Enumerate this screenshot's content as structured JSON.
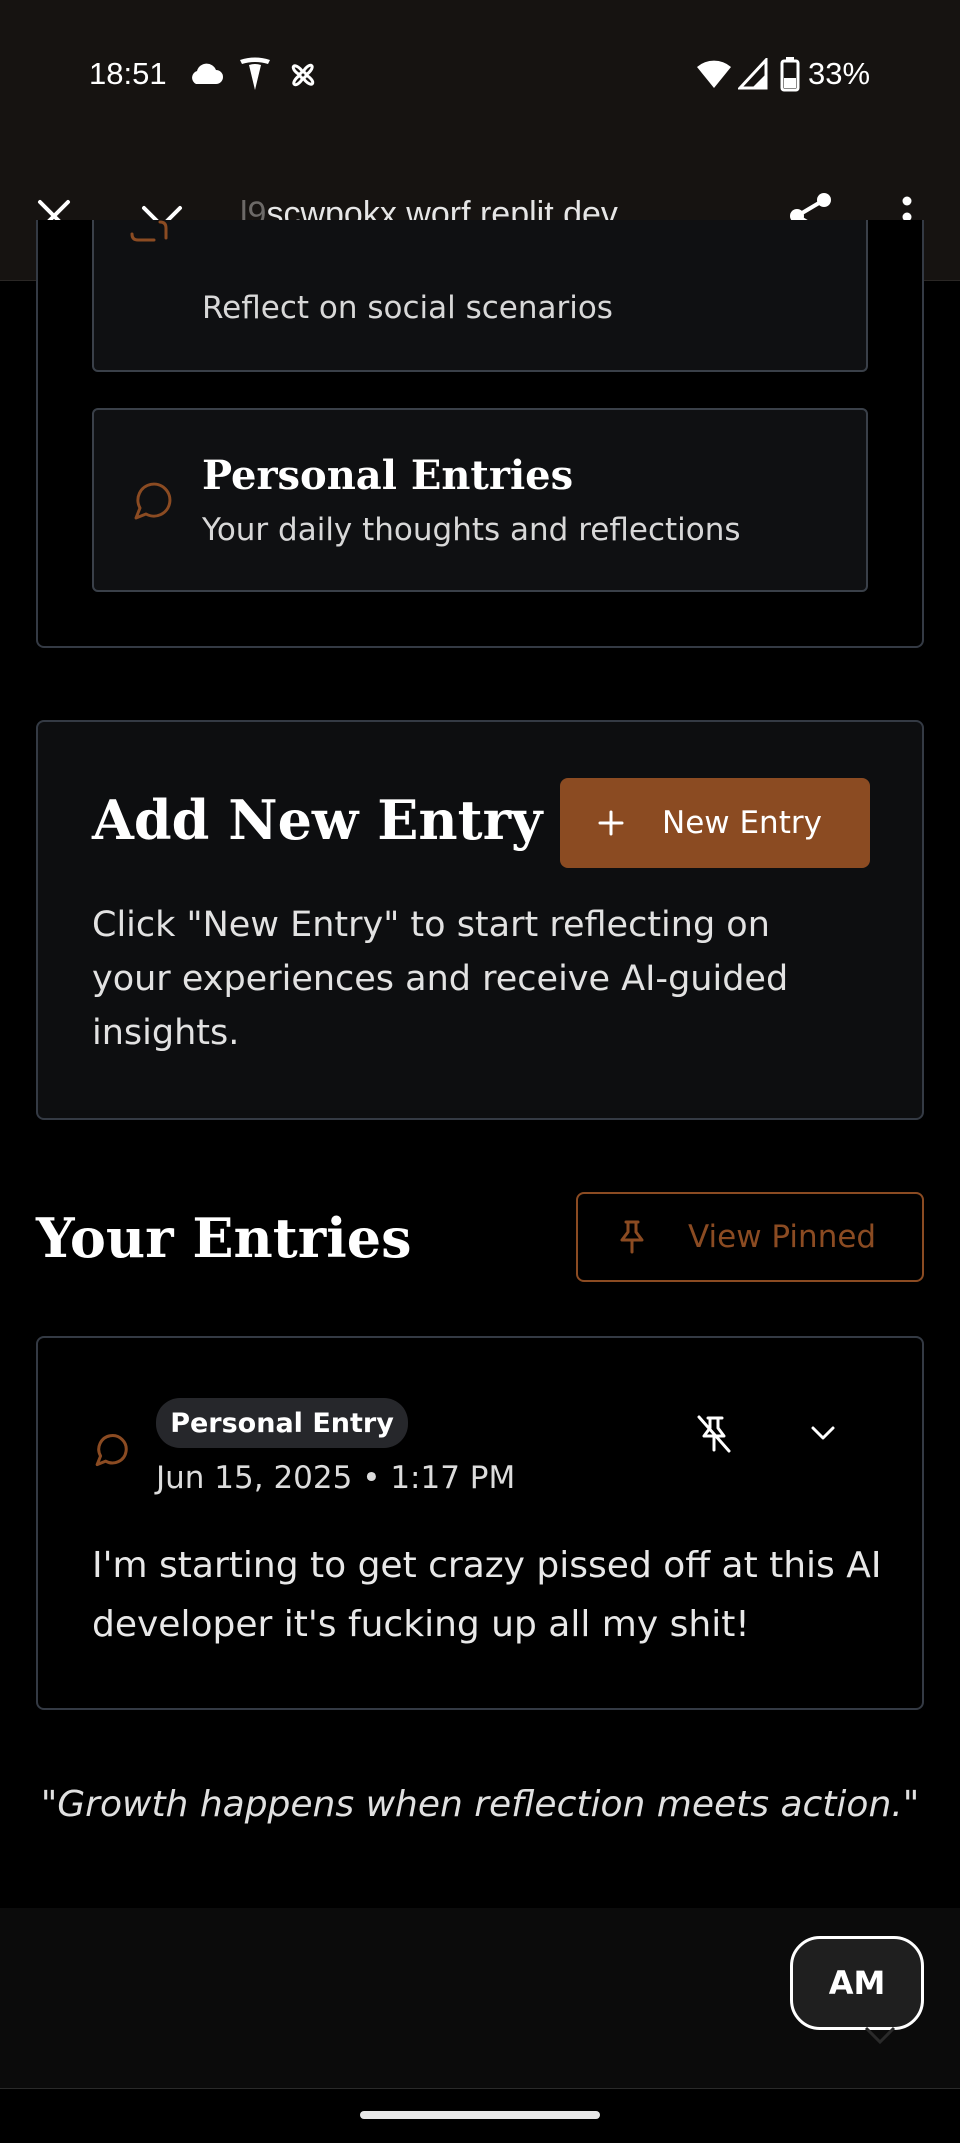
{
  "status": {
    "time": "18:51",
    "battery": "33%"
  },
  "browser": {
    "url_faded": "l9",
    "url_main": "scwpokx.worf.replit.dev"
  },
  "categories": [
    {
      "title": "",
      "desc": "Reflect on social scenarios"
    },
    {
      "title": "Personal Entries",
      "desc": "Your daily thoughts and reflections"
    }
  ],
  "add_entry": {
    "heading": "Add New Entry",
    "button_label": "New Entry",
    "description": "Click \"New Entry\" to start reflecting on your experiences and receive AI-guided insights."
  },
  "entries_section": {
    "heading": "Your Entries",
    "view_pinned_label": "View Pinned"
  },
  "entries": [
    {
      "type": "Personal Entry",
      "date": "Jun 15, 2025 • 1:17 PM",
      "text": "I'm starting to get crazy pissed off at this AI developer it's fucking up all my shit!"
    }
  ],
  "quote": "\"Growth happens when reflection meets action.\"",
  "fab": {
    "initials": "AM"
  },
  "colors": {
    "accent": "#8b4b22",
    "background": "#000000",
    "card": "#0d0e10",
    "border": "#343a44"
  }
}
